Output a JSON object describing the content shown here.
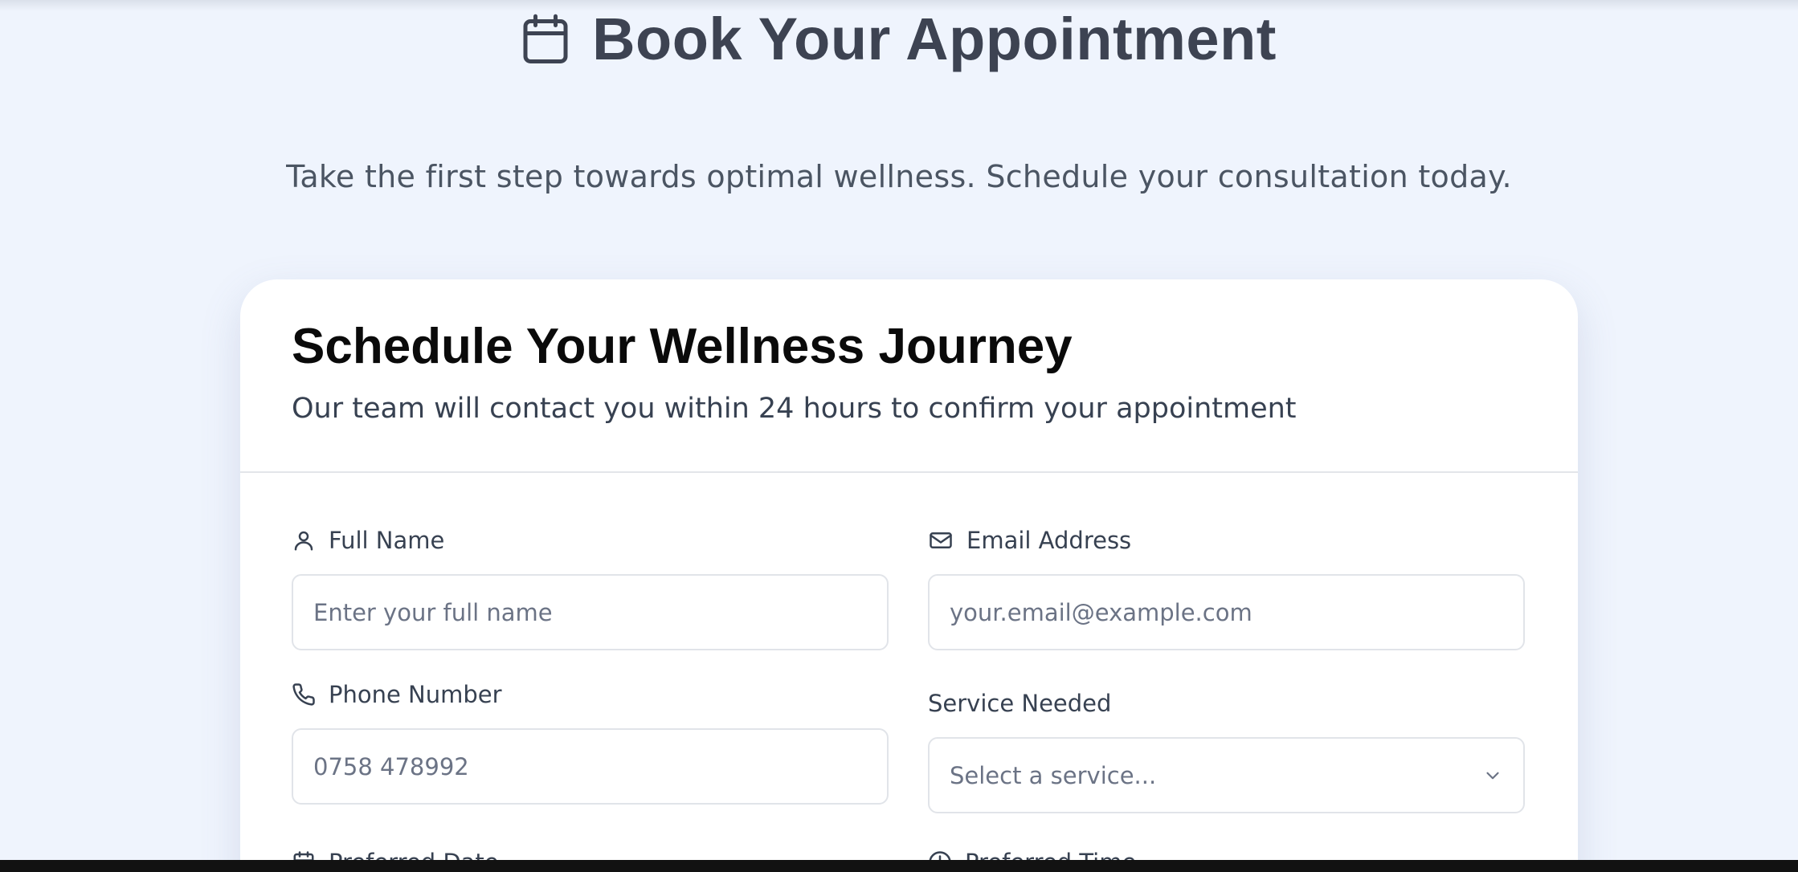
{
  "hero": {
    "title": "Book Your Appointment",
    "subtitle": "Take the first step towards optimal wellness. Schedule your consultation today."
  },
  "card": {
    "title": "Schedule Your Wellness Journey",
    "subtitle": "Our team will contact you within 24 hours to confirm your appointment"
  },
  "form": {
    "full_name": {
      "label": "Full Name",
      "placeholder": "Enter your full name",
      "icon": "user-icon"
    },
    "email": {
      "label": "Email Address",
      "placeholder": "your.email@example.com",
      "icon": "mail-icon"
    },
    "phone": {
      "label": "Phone Number",
      "placeholder": "0758 478992",
      "icon": "phone-icon"
    },
    "service": {
      "label": "Service Needed",
      "selected": "Select a service...",
      "icon": "chevron-down-icon"
    },
    "date": {
      "label": "Preferred Date",
      "icon": "calendar-icon"
    },
    "time": {
      "label": "Preferred Time",
      "icon": "clock-icon"
    }
  },
  "colors": {
    "page_bg": "#eff4fd",
    "card_bg": "#ffffff",
    "heading": "#3d4352",
    "text": "#374151"
  }
}
